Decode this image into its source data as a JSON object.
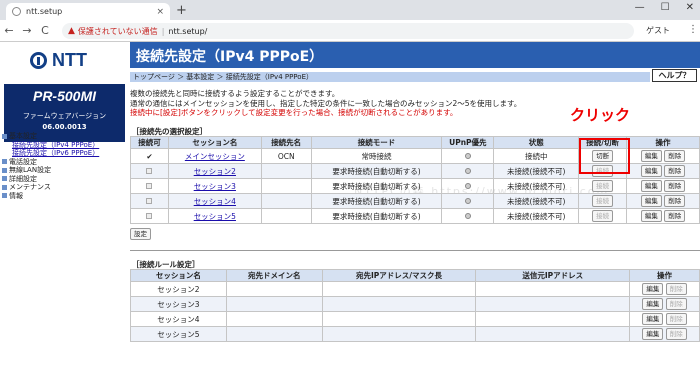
{
  "browser": {
    "tab_title": "ntt.setup",
    "tab_close": "×",
    "new_tab": "+",
    "win_min": "—",
    "win_max": "☐",
    "win_close": "✕",
    "back": "←",
    "forward": "→",
    "reload": "C",
    "warning_icon": "▲",
    "not_secure": "保護されていない通信",
    "separator": "|",
    "url": "ntt.setup/",
    "guest_label": "ゲスト",
    "menu_icon": "⋮"
  },
  "sidebar": {
    "logo_text": "NTT",
    "model": "PR-500MI",
    "firmware_label": "ファームウェアバージョン",
    "firmware_version": "06.00.0013",
    "menu": [
      {
        "label": "基本設定",
        "type": "m"
      },
      {
        "label": "接続先設定（IPv4 PPPoE）",
        "type": "sub"
      },
      {
        "label": "接続先設定（IPv6 PPPoE）",
        "type": "sub"
      },
      {
        "label": "電話設定",
        "type": "m"
      },
      {
        "label": "無線LAN設定",
        "type": "m"
      },
      {
        "label": "詳細設定",
        "type": "m"
      },
      {
        "label": "メンテナンス",
        "type": "m"
      },
      {
        "label": "情報",
        "type": "m"
      }
    ]
  },
  "main": {
    "title": "接続先設定（IPv4 PPPoE）",
    "breadcrumb": "トップページ ＞ 基本設定 ＞ 接続先設定（IPv4 PPPoE）",
    "help": "ヘルプ？",
    "desc1": "複数の接続先と同時に接続するよう設定することができます。",
    "desc2": "通常の通信にはメインセッションを使用し、指定した特定の条件に一致した場合のみセッション2〜5を使用します。",
    "desc3": "接続中に[設定]ボタンをクリックして設定変更を行った場合、接続が切断されることがあります。",
    "annotation": "クリック",
    "watermark": "NTTPCの森 https://www.pcmori.com",
    "section1_title": "［接続先の選択設定］",
    "section2_title": "［接続ルール設定］",
    "set_button": "設定",
    "btn_toggle": "切断",
    "btn_connect": "接続",
    "btn_edit": "編集",
    "btn_delete": "削除"
  },
  "table1": {
    "headers": [
      "接続可",
      "セッション名",
      "接続先名",
      "接続モード",
      "UPnP優先",
      "状態",
      "接続/切断",
      "操作"
    ],
    "rows": [
      {
        "session": "メインセッション",
        "dest": "OCN",
        "mode": "常時接続",
        "status": "接続中"
      },
      {
        "session": "セッション2",
        "dest": "",
        "mode": "要求時接続(自動切断する)",
        "status": "未接続(接続不可)"
      },
      {
        "session": "セッション3",
        "dest": "",
        "mode": "要求時接続(自動切断する)",
        "status": "未接続(接続不可)"
      },
      {
        "session": "セッション4",
        "dest": "",
        "mode": "要求時接続(自動切断する)",
        "status": "未接続(接続不可)"
      },
      {
        "session": "セッション5",
        "dest": "",
        "mode": "要求時接続(自動切断する)",
        "status": "未接続(接続不可)"
      }
    ]
  },
  "table2": {
    "headers": [
      "セッション名",
      "宛先ドメイン名",
      "宛先IPアドレス/マスク長",
      "送信元IPアドレス",
      "操作"
    ],
    "rows": [
      {
        "session": "セッション2"
      },
      {
        "session": "セッション3"
      },
      {
        "session": "セッション4"
      },
      {
        "session": "セッション5"
      }
    ]
  }
}
